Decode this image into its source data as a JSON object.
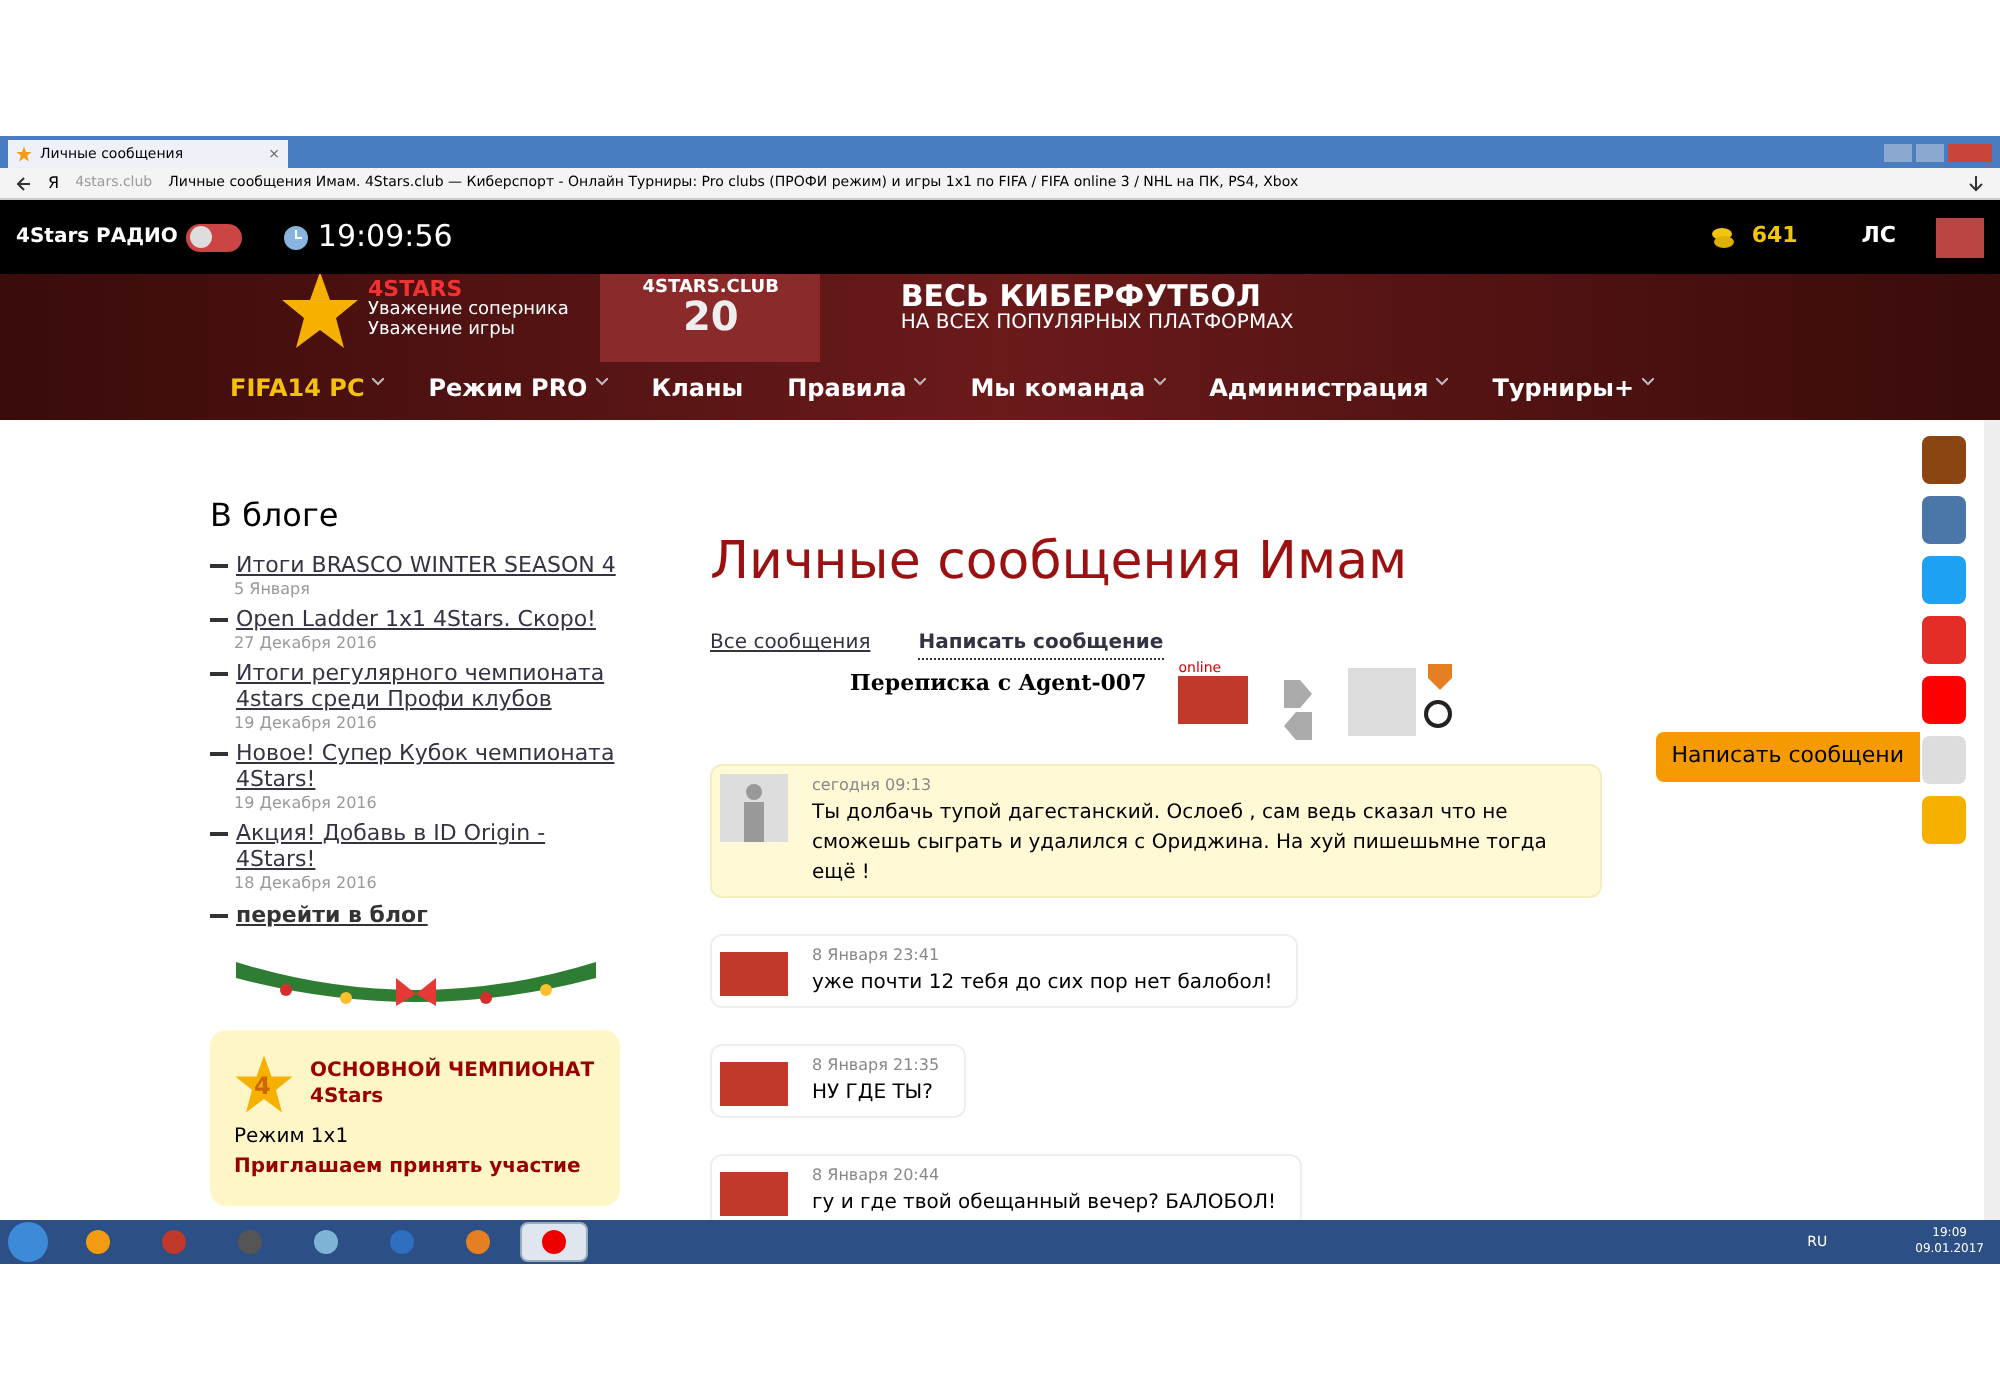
{
  "browser": {
    "tab": {
      "title": "Личные сообщения",
      "close": "×"
    },
    "yandex_button": "Я",
    "url_host": "4stars.club",
    "url_title": "Личные сообщения Имам. 4Stars.club — Киберспорт - Онлайн Турниры: Pro clubs (ПРОФИ режим) и игры 1x1 по FIFA / FIFA online 3 / NHL на ПК, PS4, Xbox"
  },
  "topbar": {
    "radio": "4Stars РАДИО",
    "radio_on": false,
    "clock": "19:09:56",
    "coins": "641",
    "messages": "ЛС"
  },
  "banner": {
    "logo": "4STARS",
    "slogan_1": "Уважение соперника",
    "slogan_2": "Уважение игры",
    "jersey_text": "4STARS.CLUB",
    "jersey_number": "20",
    "headline": "ВЕСЬ КИБЕРФУТБОЛ",
    "subheadline": "НА ВСЕХ ПОПУЛЯРНЫХ ПЛАТФОРМАХ"
  },
  "nav": [
    {
      "label": "FIFA14 PC",
      "selected": true,
      "has_menu": true
    },
    {
      "label": "Режим PRO",
      "selected": false,
      "has_menu": true
    },
    {
      "label": "Кланы",
      "selected": false,
      "has_menu": false
    },
    {
      "label": "Правила",
      "selected": false,
      "has_menu": true
    },
    {
      "label": "Мы команда",
      "selected": false,
      "has_menu": true
    },
    {
      "label": "Администрация",
      "selected": false,
      "has_menu": true
    },
    {
      "label": "Турниры+",
      "selected": false,
      "has_menu": true
    }
  ],
  "blog": {
    "title": "В блоге",
    "items": [
      {
        "title": "Итоги BRASCO WINTER SEASON 4",
        "date": "5 Января"
      },
      {
        "title": "Open Ladder 1x1 4Stars. Скоро!",
        "date": "27 Декабря 2016"
      },
      {
        "title": "Итоги регулярного чемпионата 4stars среди Профи клубов",
        "date": "19 Декабря 2016"
      },
      {
        "title": "Новое! Супер Кубок чемпионата 4Stars!",
        "date": "19 Декабря 2016"
      },
      {
        "title": "Акция! Добавь в ID Origin - 4Stars!",
        "date": "18 Декабря 2016"
      }
    ],
    "more": "перейти в блог"
  },
  "promo": {
    "badge": "4",
    "title": "ОСНОВНОЙ ЧЕМПИОНАТ",
    "subtitle": "4Stars",
    "mode": "Режим 1x1",
    "invite": "Приглашаем принять участие"
  },
  "page": {
    "title": "Личные сообщения Имам",
    "all_link": "Все сообщения",
    "write_link": "Написать сообщение",
    "conversation": "Переписка с Agent-007",
    "online": "online"
  },
  "messages": [
    {
      "kind": "incoming",
      "time": "сегодня 09:13",
      "text": "Ты долбачь тупой дагестанский. Ослоеб , сам ведь сказал что не сможешь сыграть и удалился с Ориджина. На хуй пишешьмне тогда ещё !"
    },
    {
      "kind": "outgoing",
      "time": "8 Января 23:41",
      "text": "уже почти 12 тебя до сих пор нет балобол!"
    },
    {
      "kind": "outgoing",
      "time": "8 Января 21:35",
      "text": "НУ ГДЕ ТЫ?"
    },
    {
      "kind": "outgoing",
      "time": "8 Января 20:44",
      "text": "гу и где твой обещанный вечер? БАЛОБОЛ!"
    }
  ],
  "write_tab": "Написать сообщени",
  "taskbar": {
    "apps": [
      {
        "kind": "aimp",
        "selected": false
      },
      {
        "kind": "record",
        "selected": false
      },
      {
        "kind": "calendar",
        "selected": false
      },
      {
        "kind": "paint",
        "selected": false
      },
      {
        "kind": "word",
        "selected": false
      },
      {
        "kind": "pin",
        "selected": false
      },
      {
        "kind": "yandex",
        "selected": true
      }
    ],
    "lang": "RU",
    "time": "19:09",
    "date": "09.01.2017"
  }
}
